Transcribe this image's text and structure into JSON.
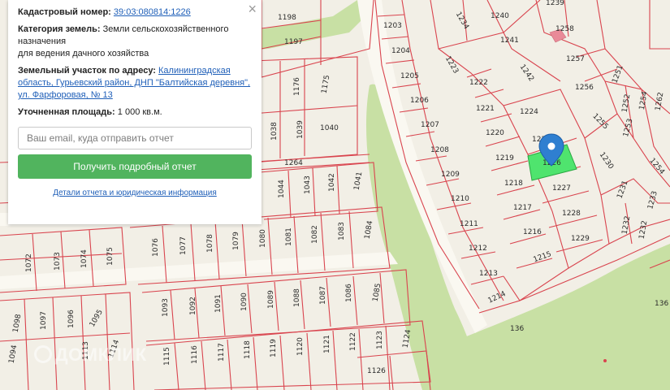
{
  "panel": {
    "cadastral_label": "Кадастровый номер:",
    "cadastral_number": "39:03:080814:1226",
    "category_label": "Категория земель:",
    "category_value": "Земли сельскохозяйственного назначения",
    "usage_value": "для ведения дачного хозяйства",
    "address_label": "Земельный участок по адресу:",
    "address_value": "Калининградская область, Гурьевский район, ДНП \"Балтийская деревня\", ул. Фарфоровая, № 13",
    "area_label": "Уточненная площадь:",
    "area_value": "1 000 кв.м.",
    "email_placeholder": "Ваш email, куда отправить отчет",
    "report_button": "Получить подробный отчет",
    "details_link": "Детали отчета и юридическая информация",
    "close_icon": "×"
  },
  "watermark": "ДОМКЛИК",
  "selected_parcel": "1226",
  "colors": {
    "parcel_stroke": "#d9444e",
    "selected_fill": "#4fe46e",
    "green_area": "#c8e0a4",
    "map_background": "#f2efe6",
    "button_green": "#51b45e",
    "marker": "#2f7fd0"
  },
  "parcel_labels": {
    "p1198": "1198",
    "p1197": "1197",
    "p1203": "1203",
    "p1204": "1204",
    "p1205": "1205",
    "p1206": "1206",
    "p1207": "1207",
    "p1208": "1208",
    "p1209": "1209",
    "p1210": "1210",
    "p1211": "1211",
    "p1212": "1212",
    "p1213": "1213",
    "p1214": "1214",
    "p1234": "1234",
    "p1239": "1239",
    "p1240": "1240",
    "p1241": "1241",
    "p1258": "1258",
    "p1257": "1257",
    "p1256": "1256",
    "p1223": "1223",
    "p1222": "1222",
    "p1242": "1242",
    "p1221": "1221",
    "p1224": "1224",
    "p1220": "1220",
    "p1225": "1225",
    "p1219": "1219",
    "p1218": "1218",
    "p1227": "1227",
    "p1217": "1217",
    "p1228": "1228",
    "p1216": "1216",
    "p1229": "1229",
    "p1215": "1215",
    "p1251": "1251",
    "p1252": "1252",
    "p1254": "1254",
    "p1255": "1255",
    "p1253": "1253",
    "p1262": "1262",
    "p1230": "1230",
    "p1231": "1231",
    "p1233": "1233",
    "p1232": "1232",
    "p1226": "1226",
    "p1264": "1264",
    "p1038": "1038",
    "p1039": "1039",
    "p1040": "1040",
    "p1176": "1176",
    "p1175": "1175",
    "p1044": "1044",
    "p1043": "1043",
    "p1042": "1042",
    "p1041": "1041",
    "p1076": "1076",
    "p1077": "1077",
    "p1078": "1078",
    "p1079": "1079",
    "p1080": "1080",
    "p1081": "1081",
    "p1082": "1082",
    "p1083": "1083",
    "p1084": "1084",
    "p1072": "1072",
    "p1073": "1073",
    "p1074": "1074",
    "p1075": "1075",
    "p1093": "1093",
    "p1092": "1092",
    "p1091": "1091",
    "p1090": "1090",
    "p1089": "1089",
    "p1088": "1088",
    "p1087": "1087",
    "p1086": "1086",
    "p1085": "1085",
    "p1098": "1098",
    "p1097": "1097",
    "p1096": "1096",
    "p1095": "1095",
    "p1115": "1115",
    "p1116": "1116",
    "p1117": "1117",
    "p1118": "1118",
    "p1119": "1119",
    "p1120": "1120",
    "p1121": "1121",
    "p1122": "1122",
    "p1123": "1123",
    "p1124": "1124",
    "p1126": "1126",
    "p1113": "1113",
    "p1114": "1114",
    "p1094": "1094",
    "p136a": "136",
    "p136b": "136"
  }
}
